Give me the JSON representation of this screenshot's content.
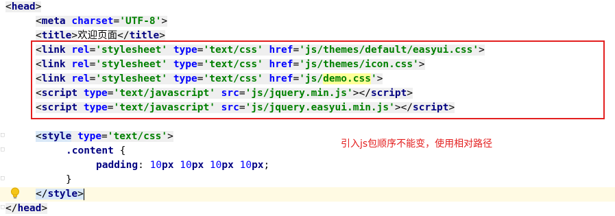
{
  "editor": {
    "lines": {
      "head_open": {
        "lt": "<",
        "tag": "head",
        "gt": ">"
      },
      "meta": {
        "lt": "<",
        "tag": "meta",
        "attr": "charset",
        "eq": "=",
        "val": "'UTF-8'",
        "gt": ">"
      },
      "title": {
        "lt": "<",
        "tag": "title",
        "gt": ">",
        "text": "欢迎页面",
        "close_lt": "</",
        "close_gt": ">"
      },
      "link1": {
        "tag": "link",
        "a1": "rel",
        "v1": "'stylesheet'",
        "a2": "type",
        "v2": "'text/css'",
        "a3": "href",
        "v3": "'js/themes/default/easyui.css'"
      },
      "link2": {
        "tag": "link",
        "a1": "rel",
        "v1": "'stylesheet'",
        "a2": "type",
        "v2": "'text/css'",
        "a3": "href",
        "v3": "'js/themes/icon.css'"
      },
      "link3": {
        "tag": "link",
        "a1": "rel",
        "v1": "'stylesheet'",
        "a2": "type",
        "v2": "'text/css'",
        "a3": "href",
        "v3a": "'js/",
        "v3b": "demo.css",
        "v3c": "'"
      },
      "script1": {
        "tag": "script",
        "a1": "type",
        "v1": "'text/javascript'",
        "a2": "src",
        "v2": "'js/jquery.min.js'"
      },
      "script2": {
        "tag": "script",
        "a1": "type",
        "v1": "'text/javascript'",
        "a2": "src",
        "v2": "'js/jquery.easyui.min.js'"
      },
      "style_open": {
        "tag": "style",
        "a1": "type",
        "v1": "'text/css'"
      },
      "selector": {
        "text": ".content",
        "brace": " {"
      },
      "padding": {
        "prop": "padding",
        "colon": ": ",
        "n1": "10",
        "u1": "px",
        "n2": "10",
        "u2": "px",
        "n3": "10",
        "u3": "px",
        "n4": "10",
        "u4": "px",
        "semi": ";"
      },
      "brace_close": {
        "text": "}"
      },
      "style_close": {
        "tag": "style"
      },
      "head_close": {
        "tag": "head"
      }
    },
    "annotation": "引入js包顺序不能变，使用相对路径",
    "colors": {
      "annotation": "#e31e1e",
      "tag": "#000080",
      "attribute": "#0000ff",
      "value": "#008000",
      "current_line": "#fffae3"
    },
    "icons": [
      "lightbulb-icon",
      "fold-marker-icon"
    ]
  }
}
